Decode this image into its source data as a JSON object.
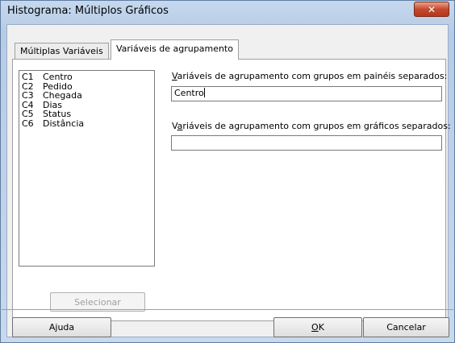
{
  "window": {
    "title": "Histograma: Múltiplos Gráficos",
    "close_glyph": "✕"
  },
  "tabs": [
    {
      "label": "Múltiplas Variáveis",
      "active": false
    },
    {
      "label": "Variáveis de agrupamento",
      "active": true
    }
  ],
  "variables": [
    {
      "col": "C1",
      "name": "Centro"
    },
    {
      "col": "C2",
      "name": "Pedido"
    },
    {
      "col": "C3",
      "name": "Chegada"
    },
    {
      "col": "C4",
      "name": "Dias"
    },
    {
      "col": "C5",
      "name": "Status"
    },
    {
      "col": "C6",
      "name": "Distância"
    }
  ],
  "select_button": "Selecionar",
  "panels_field": {
    "label_first": "V",
    "label_rest": "ariáveis de agrupamento com grupos em painéis separados:",
    "value": "Centro"
  },
  "graphs_field": {
    "label_first": "V",
    "label_mnemonic": "a",
    "label_rest": "riáveis de agrupamento com grupos em gráficos separados:",
    "value": ""
  },
  "buttons": {
    "help": "Ajuda",
    "ok_mnemonic": "O",
    "ok_rest": "K",
    "cancel": "Cancelar"
  }
}
